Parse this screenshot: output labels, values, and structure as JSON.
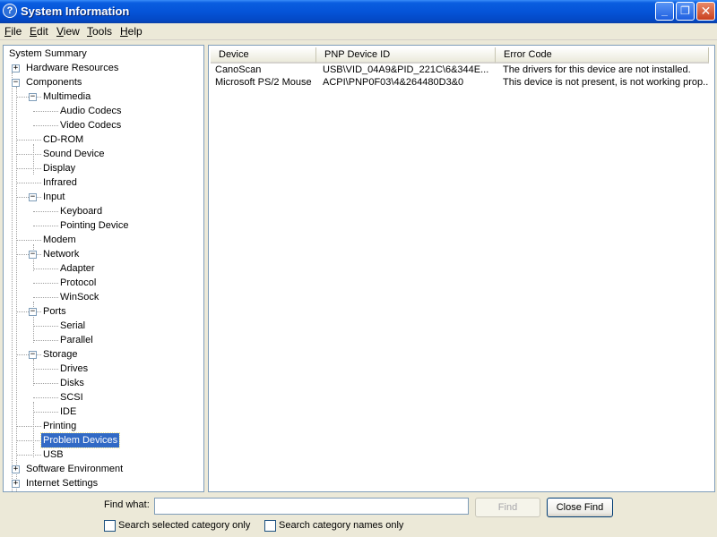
{
  "window": {
    "title": "System Information",
    "icon_glyph": "?",
    "controls": {
      "minimize": "_",
      "maximize": "❐",
      "close": "✕"
    }
  },
  "menu": [
    "File",
    "Edit",
    "View",
    "Tools",
    "Help"
  ],
  "tree": [
    {
      "label": "System Summary",
      "level": 0,
      "expander": ""
    },
    {
      "label": "Hardware Resources",
      "level": 1,
      "expander": "+"
    },
    {
      "label": "Components",
      "level": 1,
      "expander": "-"
    },
    {
      "label": "Multimedia",
      "level": 2,
      "expander": "-"
    },
    {
      "label": "Audio Codecs",
      "level": 3,
      "expander": ""
    },
    {
      "label": "Video Codecs",
      "level": 3,
      "expander": ""
    },
    {
      "label": "CD-ROM",
      "level": 2,
      "expander": ""
    },
    {
      "label": "Sound Device",
      "level": 2,
      "expander": ""
    },
    {
      "label": "Display",
      "level": 2,
      "expander": ""
    },
    {
      "label": "Infrared",
      "level": 2,
      "expander": ""
    },
    {
      "label": "Input",
      "level": 2,
      "expander": "-"
    },
    {
      "label": "Keyboard",
      "level": 3,
      "expander": ""
    },
    {
      "label": "Pointing Device",
      "level": 3,
      "expander": ""
    },
    {
      "label": "Modem",
      "level": 2,
      "expander": ""
    },
    {
      "label": "Network",
      "level": 2,
      "expander": "-"
    },
    {
      "label": "Adapter",
      "level": 3,
      "expander": ""
    },
    {
      "label": "Protocol",
      "level": 3,
      "expander": ""
    },
    {
      "label": "WinSock",
      "level": 3,
      "expander": ""
    },
    {
      "label": "Ports",
      "level": 2,
      "expander": "-"
    },
    {
      "label": "Serial",
      "level": 3,
      "expander": ""
    },
    {
      "label": "Parallel",
      "level": 3,
      "expander": ""
    },
    {
      "label": "Storage",
      "level": 2,
      "expander": "-"
    },
    {
      "label": "Drives",
      "level": 3,
      "expander": ""
    },
    {
      "label": "Disks",
      "level": 3,
      "expander": ""
    },
    {
      "label": "SCSI",
      "level": 3,
      "expander": ""
    },
    {
      "label": "IDE",
      "level": 3,
      "expander": ""
    },
    {
      "label": "Printing",
      "level": 2,
      "expander": ""
    },
    {
      "label": "Problem Devices",
      "level": 2,
      "expander": "",
      "selected": true
    },
    {
      "label": "USB",
      "level": 2,
      "expander": ""
    },
    {
      "label": "Software Environment",
      "level": 1,
      "expander": "+"
    },
    {
      "label": "Internet Settings",
      "level": 1,
      "expander": "+"
    }
  ],
  "list": {
    "columns": [
      "Device",
      "PNP Device ID",
      "Error Code"
    ],
    "rows": [
      [
        "CanoScan",
        "USB\\VID_04A9&PID_221C\\6&344E...",
        "The drivers for this device are not installed."
      ],
      [
        "Microsoft PS/2 Mouse",
        "ACPI\\PNP0F03\\4&264480D3&0",
        "This device is not present, is not working prop..."
      ]
    ]
  },
  "find": {
    "label": "Find what:",
    "value": "",
    "find_button": "Find",
    "close_find_button": "Close Find",
    "opt_selected_category": "Search selected category only",
    "opt_category_names": "Search category names only"
  }
}
